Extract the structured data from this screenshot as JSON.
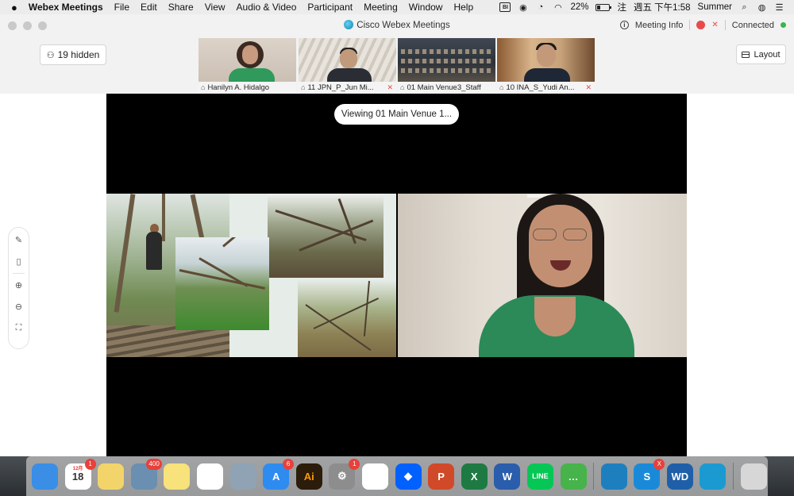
{
  "menubar": {
    "app_name": "Webex Meetings",
    "menus": [
      "File",
      "Edit",
      "Share",
      "View",
      "Audio & Video",
      "Participant",
      "Meeting",
      "Window",
      "Help"
    ],
    "battery_percent": "22%",
    "battery_level": 0.22,
    "clock": "週五 下午1:58",
    "user": "Summer",
    "input_method": "注"
  },
  "window": {
    "title": "Cisco Webex Meetings",
    "meeting_info_label": "Meeting Info",
    "connection_status": "Connected"
  },
  "participants_bar": {
    "hidden_label": "19 hidden",
    "layout_label": "Layout",
    "thumbnails": [
      {
        "name": "Hanilyn A. Hidalgo",
        "muted": false,
        "active": true
      },
      {
        "name": "11 JPN_P_Jun Mi...",
        "muted": true,
        "active": false
      },
      {
        "name": "01 Main Venue3_Staff",
        "muted": false,
        "active": false
      },
      {
        "name": "10 INA_S_Yudi An...",
        "muted": true,
        "active": false
      }
    ]
  },
  "stage": {
    "viewing_label": "Viewing 01 Main Venue 1..."
  },
  "dock": {
    "apps": [
      {
        "name": "Finder",
        "label": "",
        "color": "#3a8ee6"
      },
      {
        "name": "Calendar",
        "label": "18",
        "sub": "12月",
        "color": "#ffffff",
        "badge": "1"
      },
      {
        "name": "Stickies",
        "label": "",
        "color": "#f2d46b"
      },
      {
        "name": "Preview",
        "label": "",
        "color": "#6a8fb0",
        "badge": "400"
      },
      {
        "name": "Notes",
        "label": "",
        "color": "#f7e27b"
      },
      {
        "name": "Reminders",
        "label": "",
        "color": "#ffffff"
      },
      {
        "name": "Image Capture",
        "label": "",
        "color": "#8fa3b5"
      },
      {
        "name": "App Store",
        "label": "A",
        "color": "#2e8cf0",
        "badge": "6"
      },
      {
        "name": "Illustrator",
        "label": "Ai",
        "color": "#2b1c0b"
      },
      {
        "name": "System Preferences",
        "label": "⚙",
        "color": "#8d8d8d",
        "badge": "1"
      },
      {
        "name": "Chrome",
        "label": "",
        "color": "#ffffff"
      },
      {
        "name": "Dropbox",
        "label": "◆",
        "color": "#0061fe"
      },
      {
        "name": "PowerPoint",
        "label": "P",
        "color": "#d04a29"
      },
      {
        "name": "Excel",
        "label": "X",
        "color": "#1e7a43"
      },
      {
        "name": "Word",
        "label": "W",
        "color": "#2a5dab"
      },
      {
        "name": "LINE",
        "label": "LINE",
        "color": "#06c755"
      },
      {
        "name": "WeChat",
        "label": "…",
        "color": "#47b34b"
      },
      {
        "name": "Webex",
        "label": "",
        "color": "#1e7fbf"
      },
      {
        "name": "Skype",
        "label": "S",
        "color": "#1a8ad8",
        "badge": "X"
      },
      {
        "name": "WD Discovery",
        "label": "WD",
        "color": "#1f5fa8"
      },
      {
        "name": "Webex Meetings",
        "label": "",
        "color": "#1b9ad1"
      },
      {
        "name": "Trash",
        "label": "",
        "color": "#d7d7d7"
      }
    ]
  }
}
